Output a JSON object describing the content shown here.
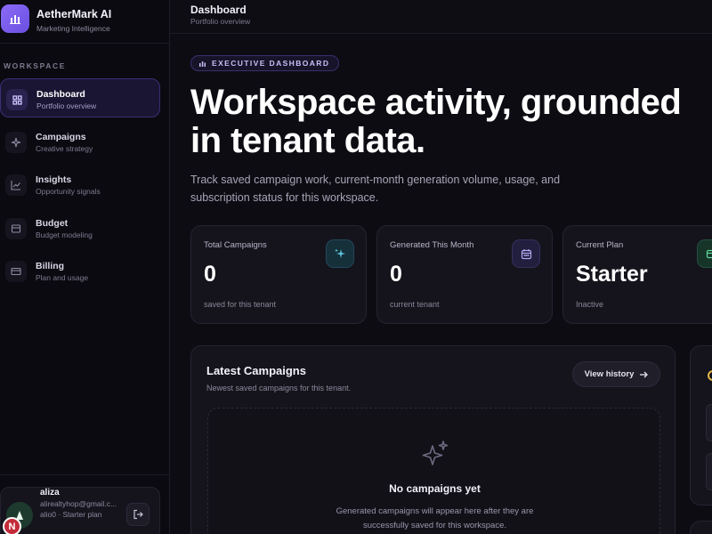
{
  "brand": {
    "title": "AetherMark AI",
    "subtitle": "Marketing Intelligence"
  },
  "sidebar": {
    "section_label": "WORKSPACE",
    "items": [
      {
        "label": "Dashboard",
        "sub": "Portfolio overview",
        "icon": "grid-icon",
        "active": true
      },
      {
        "label": "Campaigns",
        "sub": "Creative strategy",
        "icon": "sparkles-icon",
        "active": false
      },
      {
        "label": "Insights",
        "sub": "Opportunity signals",
        "icon": "chart-line-icon",
        "active": false
      },
      {
        "label": "Budget",
        "sub": "Budget modeling",
        "icon": "wallet-icon",
        "active": false
      },
      {
        "label": "Billing",
        "sub": "Plan and usage",
        "icon": "credit-card-icon",
        "active": false
      }
    ],
    "user": {
      "name": "aliza",
      "email": "alirealtyhop@gmail.c...",
      "plan": "alio0 · Starter plan",
      "badge": "N"
    }
  },
  "topbar": {
    "title": "Dashboard",
    "subtitle": "Portfolio overview"
  },
  "main": {
    "pill": "EXECUTIVE DASHBOARD",
    "hero": "Workspace activity, grounded in tenant data.",
    "description": "Track saved campaign work, current-month generation volume, usage, and subscription status for this workspace.",
    "stats": [
      {
        "label": "Total Campaigns",
        "value": "0",
        "foot": "saved for this tenant",
        "icon": "sparkles-icon",
        "accent": "#5ec8e0"
      },
      {
        "label": "Generated This Month",
        "value": "0",
        "foot": "current tenant",
        "icon": "calendar-icon",
        "accent": "#a99cf0"
      },
      {
        "label": "Current Plan",
        "value": "Starter",
        "foot": "Inactive",
        "icon": "card-icon",
        "accent": "#5fd79a"
      }
    ],
    "latest": {
      "title": "Latest Campaigns",
      "subtitle": "Newest saved campaigns for this tenant.",
      "button": "View history",
      "empty_title": "No campaigns yet",
      "empty_desc": "Generated campaigns will appear here after they are successfully saved for this workspace."
    }
  },
  "colors": {
    "accent": "#7c5cf2",
    "background": "#0d0c13"
  }
}
